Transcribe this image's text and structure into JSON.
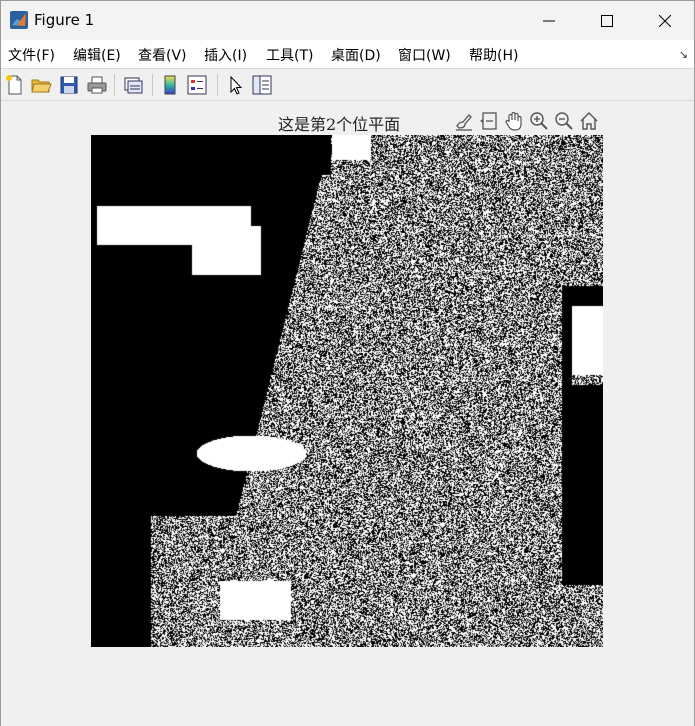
{
  "window": {
    "title": "Figure 1"
  },
  "menubar": {
    "items": [
      "文件(F)",
      "编辑(E)",
      "查看(V)",
      "插入(I)",
      "工具(T)",
      "桌面(D)",
      "窗口(W)",
      "帮助(H)"
    ]
  },
  "toolbar": {
    "icons": [
      "new-figure-icon",
      "open-file-icon",
      "save-icon",
      "print-icon",
      "link-plot-icon",
      "colorbar-icon",
      "legend-icon",
      "edit-plot-icon",
      "property-inspector-icon"
    ]
  },
  "axes": {
    "title": "这是第2个位平面",
    "toolbar_icons": [
      "brush-icon",
      "data-tips-icon",
      "pan-icon",
      "zoom-in-icon",
      "zoom-out-icon",
      "home-icon"
    ]
  },
  "image": {
    "content": "binary bit-plane image (black and white noise pattern)"
  },
  "colors": {
    "background": "#f0f0f0",
    "titlebar": "#f3f3f3",
    "menubar": "#ffffff"
  }
}
